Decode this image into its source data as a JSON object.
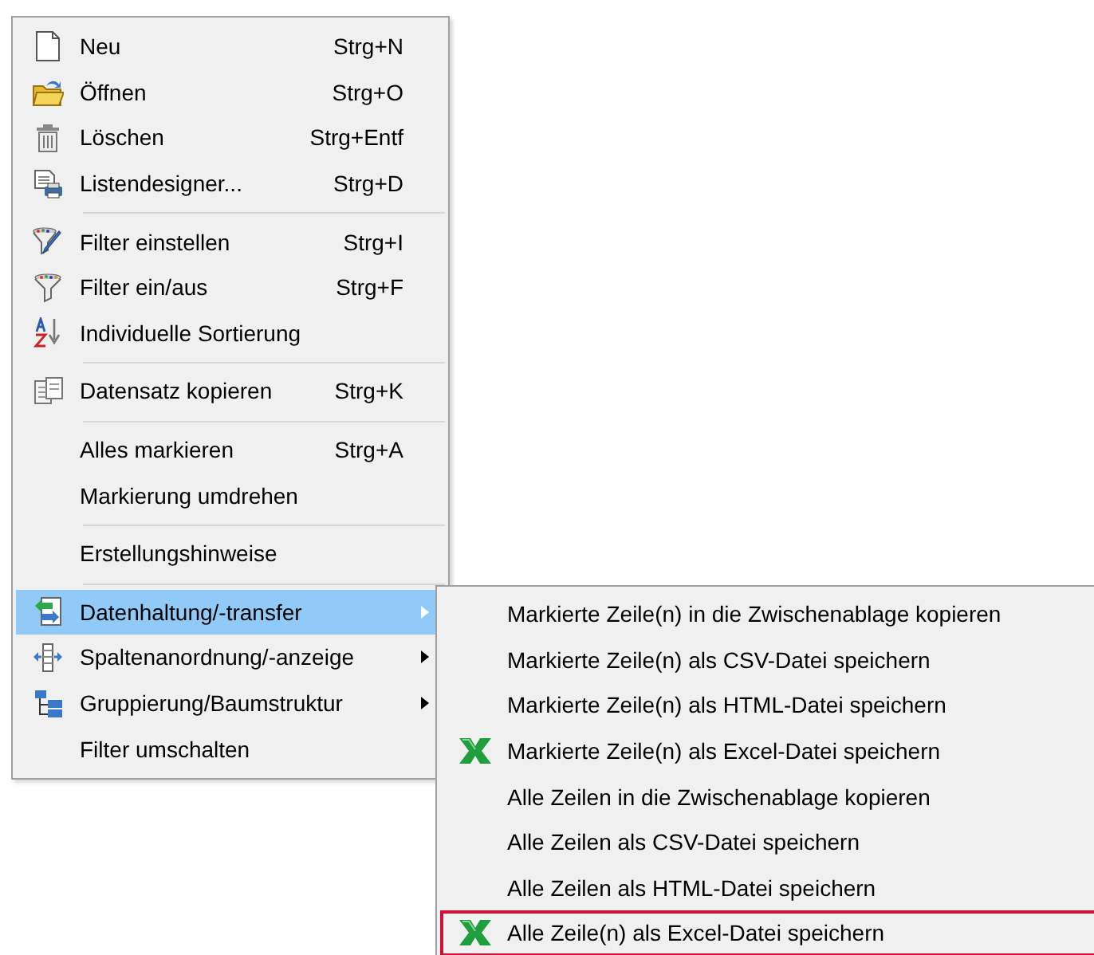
{
  "menu": {
    "items": [
      {
        "kind": "item",
        "label": "Neu",
        "shortcut": "Strg+N",
        "submenu": false,
        "selected": false
      },
      {
        "kind": "item",
        "label": "Öffnen",
        "shortcut": "Strg+O",
        "submenu": false,
        "selected": false
      },
      {
        "kind": "item",
        "label": "Löschen",
        "shortcut": "Strg+Entf",
        "submenu": false,
        "selected": false
      },
      {
        "kind": "item",
        "label": "Listendesigner...",
        "shortcut": "Strg+D",
        "submenu": false,
        "selected": false
      },
      {
        "kind": "separator"
      },
      {
        "kind": "item",
        "label": "Filter einstellen",
        "shortcut": "Strg+I",
        "submenu": false,
        "selected": false
      },
      {
        "kind": "item",
        "label": "Filter ein/aus",
        "shortcut": "Strg+F",
        "submenu": false,
        "selected": false
      },
      {
        "kind": "item",
        "label": "Individuelle Sortierung",
        "submenu": false,
        "selected": false
      },
      {
        "kind": "separator"
      },
      {
        "kind": "item",
        "label": "Datensatz kopieren",
        "shortcut": "Strg+K",
        "submenu": false,
        "selected": false
      },
      {
        "kind": "separator"
      },
      {
        "kind": "item",
        "label": "Alles markieren",
        "shortcut": "Strg+A",
        "submenu": false,
        "selected": false
      },
      {
        "kind": "item",
        "label": "Markierung umdrehen",
        "submenu": false,
        "selected": false
      },
      {
        "kind": "separator"
      },
      {
        "kind": "item",
        "label": "Erstellungshinweise",
        "submenu": false,
        "selected": false
      },
      {
        "kind": "separator"
      },
      {
        "kind": "item",
        "label": "Datenhaltung/-transfer",
        "submenu": true,
        "selected": true
      },
      {
        "kind": "item",
        "label": "Spaltenanordnung/-anzeige",
        "submenu": true,
        "selected": false
      },
      {
        "kind": "item",
        "label": "Gruppierung/Baumstruktur",
        "submenu": true,
        "selected": false
      },
      {
        "kind": "item",
        "label": "Filter umschalten",
        "submenu": false,
        "selected": false
      }
    ]
  },
  "submenu": {
    "items": [
      {
        "label": "Markierte Zeile(n) in die Zwischenablage kopieren",
        "selected": false
      },
      {
        "label": "Markierte Zeile(n) als CSV-Datei speichern",
        "selected": false
      },
      {
        "label": "Markierte Zeile(n) als HTML-Datei speichern",
        "selected": false
      },
      {
        "label": "Markierte Zeile(n) als Excel-Datei speichern",
        "selected": false
      },
      {
        "label": "Alle Zeilen in die Zwischenablage kopieren",
        "selected": false
      },
      {
        "label": "Alle Zeilen als CSV-Datei speichern",
        "selected": false
      },
      {
        "label": "Alle Zeilen als HTML-Datei speichern",
        "selected": false
      },
      {
        "label": "Alle Zeile(n) als Excel-Datei speichern",
        "selected": true
      }
    ]
  }
}
